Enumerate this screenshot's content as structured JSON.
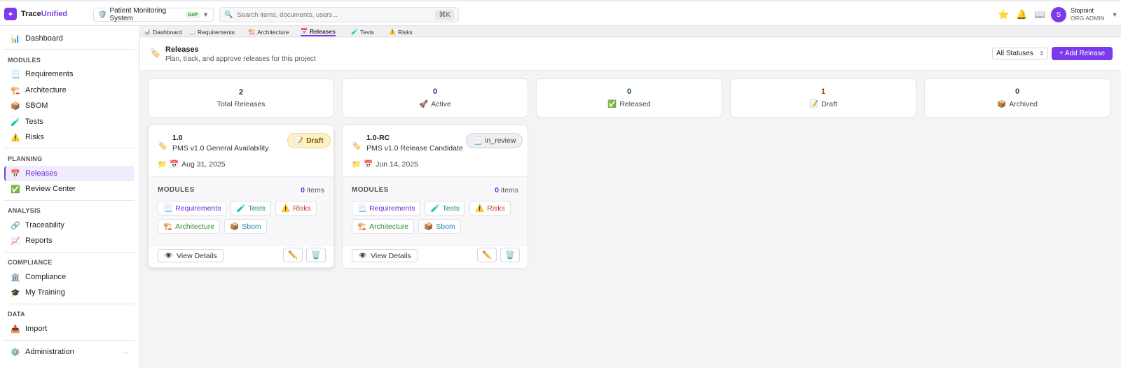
{
  "app": {
    "brand_prefix": "Trace",
    "brand_accent": "Unified",
    "accent_color": "#7c3aed"
  },
  "topbar": {
    "project_name": "Patient Monitoring System",
    "project_badge": "GxP",
    "search_placeholder": "Search items, documents, users...",
    "search_shortcut": "⌘K",
    "user_name": "Stopoint",
    "user_role": "ORG ADMIN",
    "user_initial": "S"
  },
  "sidebar": {
    "dashboard": "Dashboard",
    "sections": {
      "modules": "MODULES",
      "planning": "PLANNING",
      "analysis": "ANALYSIS",
      "compliance": "COMPLIANCE",
      "data": "DATA"
    },
    "items": {
      "requirements": "Requirements",
      "architecture": "Architecture",
      "sbom": "SBOM",
      "tests": "Tests",
      "risks": "Risks",
      "releases": "Releases",
      "review_center": "Review Center",
      "traceability": "Traceability",
      "reports": "Reports",
      "compliance": "Compliance",
      "my_training": "My Training",
      "import": "Import",
      "administration": "Administration"
    }
  },
  "tabs": [
    "Dashboard",
    "Requirements",
    "Architecture",
    "Releases",
    "Tests",
    "Risks"
  ],
  "page": {
    "title": "Releases",
    "subtitle": "Plan, track, and approve releases for this project",
    "status_filter": "All Statuses",
    "add_button": "+ Add Release"
  },
  "stats": [
    {
      "value": "2",
      "label": "Total Releases",
      "icon": "",
      "color": "#222222"
    },
    {
      "value": "0",
      "label": "Active",
      "icon": "🚀",
      "color": "#1e3a8a"
    },
    {
      "value": "0",
      "label": "Released",
      "icon": "✅",
      "color": "#14532d"
    },
    {
      "value": "1",
      "label": "Draft",
      "icon": "📝",
      "color": "#92400e"
    },
    {
      "value": "0",
      "label": "Archived",
      "icon": "📦",
      "color": "#444444"
    }
  ],
  "releases": [
    {
      "version": "1.0",
      "name": "PMS v1.0 General Availability",
      "date": "Aug 31, 2025",
      "status": "Draft",
      "modules_label": "MODULES",
      "count": "0",
      "count_suffix": "items",
      "modules": [
        "Requirements",
        "Tests",
        "Risks",
        "Architecture",
        "Sbom"
      ],
      "view_label": "View Details"
    },
    {
      "version": "1.0-RC",
      "name": "PMS v1.0 Release Candidate",
      "date": "Jun 14, 2025",
      "status": "in_review",
      "modules_label": "MODULES",
      "count": "0",
      "count_suffix": "items",
      "modules": [
        "Requirements",
        "Tests",
        "Risks",
        "Architecture",
        "Sbom"
      ],
      "view_label": "View Details"
    }
  ]
}
